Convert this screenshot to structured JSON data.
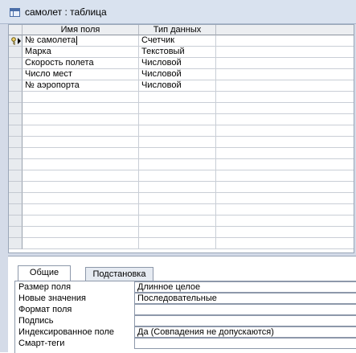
{
  "window": {
    "title": "самолет : таблица",
    "icon": "table-icon"
  },
  "design_grid": {
    "columns": [
      "Имя поля",
      "Тип данных"
    ],
    "rows": [
      {
        "name": "№ самолета",
        "type": "Счетчик",
        "primary_key": true,
        "current": true
      },
      {
        "name": "Марка",
        "type": "Текстовый"
      },
      {
        "name": "Скорость полета",
        "type": "Числовой"
      },
      {
        "name": "Число мест",
        "type": "Числовой"
      },
      {
        "name": "№ аэропорта",
        "type": "Числовой"
      }
    ]
  },
  "properties": {
    "tabs": [
      {
        "label": "Общие",
        "active": true
      },
      {
        "label": "Подстановка",
        "active": false
      }
    ],
    "fields": [
      {
        "label": "Размер поля",
        "value": "Длинное целое"
      },
      {
        "label": "Новые значения",
        "value": "Последовательные"
      },
      {
        "label": "Формат поля",
        "value": ""
      },
      {
        "label": "Подпись",
        "value": ""
      },
      {
        "label": "Индексированное поле",
        "value": "Да (Совпадения не допускаются)"
      },
      {
        "label": "Смарт-теги",
        "value": ""
      }
    ]
  }
}
